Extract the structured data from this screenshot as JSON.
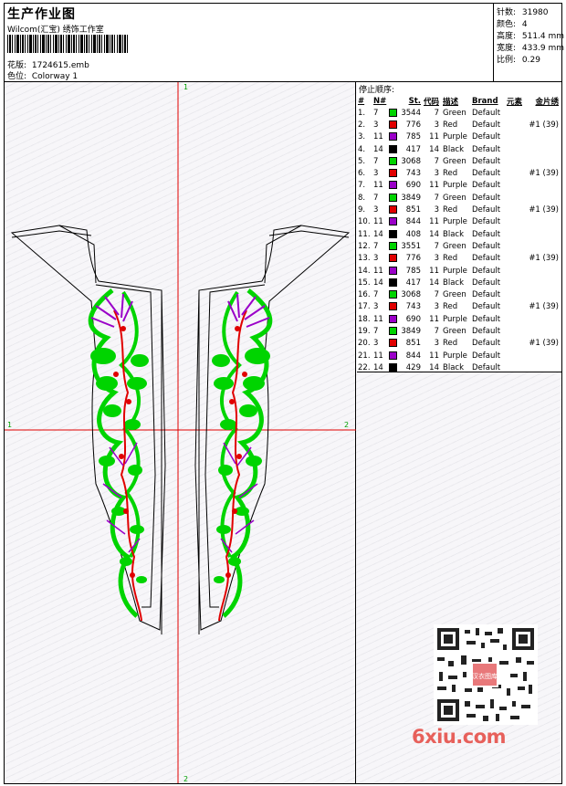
{
  "header": {
    "title": "生产作业图",
    "studio": "Wilcom(汇宝) 绣饰工作室",
    "design_label": "花版:",
    "design_value": "1724615.emb",
    "colorway_label": "色位:",
    "colorway_value": "Colorway 1"
  },
  "stats": [
    {
      "label": "针数:",
      "value": "31980"
    },
    {
      "label": "颜色:",
      "value": "4"
    },
    {
      "label": "高度:",
      "value": "511.4 mm"
    },
    {
      "label": "宽度:",
      "value": "433.9 mm"
    },
    {
      "label": "比例:",
      "value": "0.29"
    }
  ],
  "axis_labels": {
    "top": "1",
    "bottom": "2",
    "left": "1",
    "right": "2"
  },
  "stop_sequence": {
    "title": "停止顺序:",
    "columns": [
      "#",
      "N#",
      "St.",
      "代码",
      "描述",
      "Brand",
      "元素",
      "金片绣"
    ],
    "rows": [
      {
        "no": "1.",
        "n": "7",
        "color": "#00d400",
        "st": "3544",
        "code": "7",
        "desc": "Green",
        "brand": "Default",
        "seq": ""
      },
      {
        "no": "2.",
        "n": "3",
        "color": "#e00000",
        "st": "776",
        "code": "3",
        "desc": "Red",
        "brand": "Default",
        "seq": "#1 (39)"
      },
      {
        "no": "3.",
        "n": "11",
        "color": "#9a00c8",
        "st": "785",
        "code": "11",
        "desc": "Purple",
        "brand": "Default",
        "seq": ""
      },
      {
        "no": "4.",
        "n": "14",
        "color": "#000000",
        "st": "417",
        "code": "14",
        "desc": "Black",
        "brand": "Default",
        "seq": ""
      },
      {
        "no": "5.",
        "n": "7",
        "color": "#00d400",
        "st": "3068",
        "code": "7",
        "desc": "Green",
        "brand": "Default",
        "seq": ""
      },
      {
        "no": "6.",
        "n": "3",
        "color": "#e00000",
        "st": "743",
        "code": "3",
        "desc": "Red",
        "brand": "Default",
        "seq": "#1 (39)"
      },
      {
        "no": "7.",
        "n": "11",
        "color": "#9a00c8",
        "st": "690",
        "code": "11",
        "desc": "Purple",
        "brand": "Default",
        "seq": ""
      },
      {
        "no": "8.",
        "n": "7",
        "color": "#00d400",
        "st": "3849",
        "code": "7",
        "desc": "Green",
        "brand": "Default",
        "seq": ""
      },
      {
        "no": "9.",
        "n": "3",
        "color": "#e00000",
        "st": "851",
        "code": "3",
        "desc": "Red",
        "brand": "Default",
        "seq": "#1 (39)"
      },
      {
        "no": "10.",
        "n": "11",
        "color": "#9a00c8",
        "st": "844",
        "code": "11",
        "desc": "Purple",
        "brand": "Default",
        "seq": ""
      },
      {
        "no": "11.",
        "n": "14",
        "color": "#000000",
        "st": "408",
        "code": "14",
        "desc": "Black",
        "brand": "Default",
        "seq": ""
      },
      {
        "no": "12.",
        "n": "7",
        "color": "#00d400",
        "st": "3551",
        "code": "7",
        "desc": "Green",
        "brand": "Default",
        "seq": ""
      },
      {
        "no": "13.",
        "n": "3",
        "color": "#e00000",
        "st": "776",
        "code": "3",
        "desc": "Red",
        "brand": "Default",
        "seq": "#1 (39)"
      },
      {
        "no": "14.",
        "n": "11",
        "color": "#9a00c8",
        "st": "785",
        "code": "11",
        "desc": "Purple",
        "brand": "Default",
        "seq": ""
      },
      {
        "no": "15.",
        "n": "14",
        "color": "#000000",
        "st": "417",
        "code": "14",
        "desc": "Black",
        "brand": "Default",
        "seq": ""
      },
      {
        "no": "16.",
        "n": "7",
        "color": "#00d400",
        "st": "3068",
        "code": "7",
        "desc": "Green",
        "brand": "Default",
        "seq": ""
      },
      {
        "no": "17.",
        "n": "3",
        "color": "#e00000",
        "st": "743",
        "code": "3",
        "desc": "Red",
        "brand": "Default",
        "seq": "#1 (39)"
      },
      {
        "no": "18.",
        "n": "11",
        "color": "#9a00c8",
        "st": "690",
        "code": "11",
        "desc": "Purple",
        "brand": "Default",
        "seq": ""
      },
      {
        "no": "19.",
        "n": "7",
        "color": "#00d400",
        "st": "3849",
        "code": "7",
        "desc": "Green",
        "brand": "Default",
        "seq": ""
      },
      {
        "no": "20.",
        "n": "3",
        "color": "#e00000",
        "st": "851",
        "code": "3",
        "desc": "Red",
        "brand": "Default",
        "seq": "#1 (39)"
      },
      {
        "no": "21.",
        "n": "11",
        "color": "#9a00c8",
        "st": "844",
        "code": "11",
        "desc": "Purple",
        "brand": "Default",
        "seq": ""
      },
      {
        "no": "22.",
        "n": "14",
        "color": "#000000",
        "st": "429",
        "code": "14",
        "desc": "Black",
        "brand": "Default",
        "seq": ""
      }
    ]
  },
  "qr_stamp_text": "汉衣图库",
  "watermark": "6xiu.com",
  "colors": {
    "axis": "#e00000",
    "green": "#00d400",
    "red": "#e00000",
    "purple": "#9a00c8",
    "black": "#000000"
  }
}
